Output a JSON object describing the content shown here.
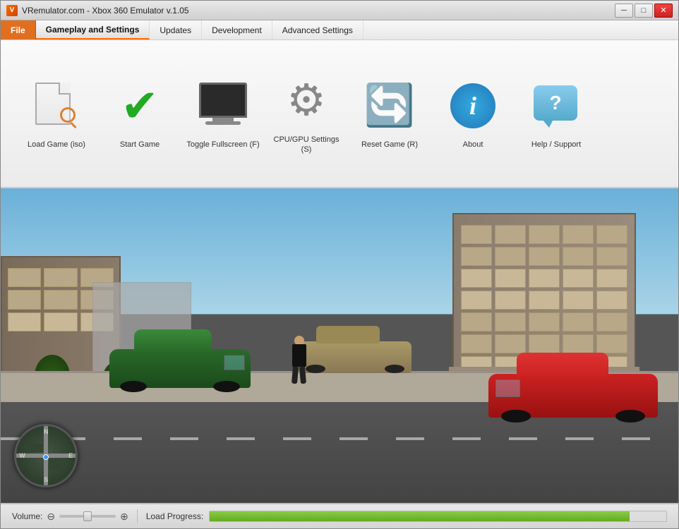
{
  "window": {
    "title": "VRemulator.com - Xbox 360 Emulator v.1.05"
  },
  "titlebar": {
    "minimize": "─",
    "maximize": "□",
    "close": "✕"
  },
  "menubar": {
    "items": [
      {
        "id": "file",
        "label": "File",
        "active": false,
        "file": true
      },
      {
        "id": "gameplay",
        "label": "Gameplay and Settings",
        "active": true
      },
      {
        "id": "updates",
        "label": "Updates",
        "active": false
      },
      {
        "id": "development",
        "label": "Development",
        "active": false
      },
      {
        "id": "advanced",
        "label": "Advanced Settings",
        "active": false
      }
    ]
  },
  "toolbar": {
    "items": [
      {
        "id": "load-game",
        "label": "Load Game (iso)"
      },
      {
        "id": "start-game",
        "label": "Start Game"
      },
      {
        "id": "fullscreen",
        "label": "Toggle Fullscreen (F)"
      },
      {
        "id": "cpu-gpu",
        "label": "CPU/GPU Settings (S)"
      },
      {
        "id": "reset-game",
        "label": "Reset Game (R)"
      },
      {
        "id": "about",
        "label": "About"
      },
      {
        "id": "help",
        "label": "Help / Support"
      }
    ]
  },
  "statusbar": {
    "volume_label": "Volume:",
    "progress_label": "Load Progress:",
    "progress_value": 92
  }
}
